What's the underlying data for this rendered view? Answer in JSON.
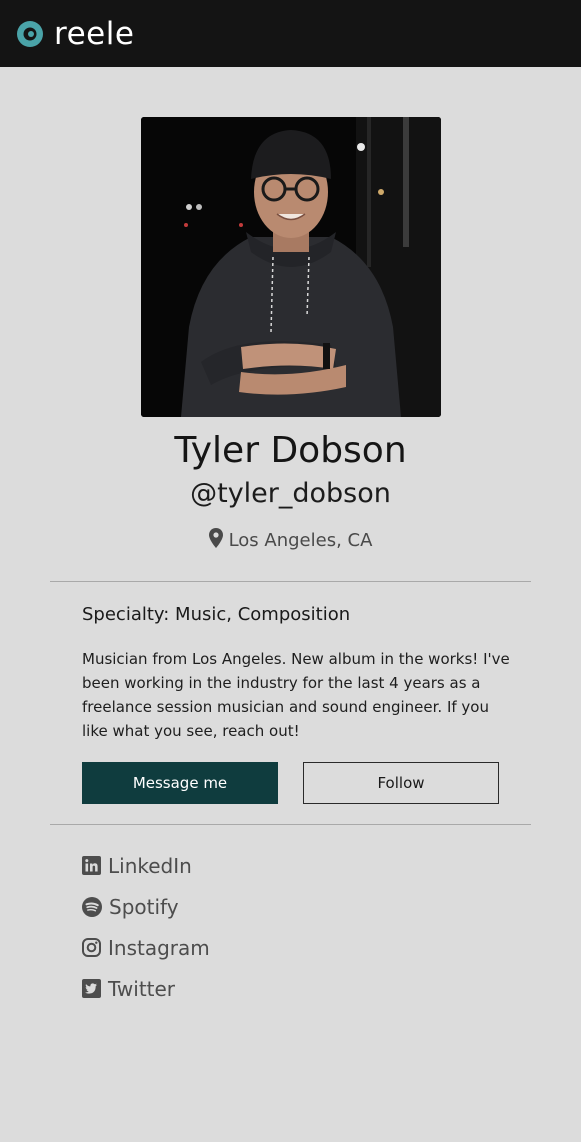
{
  "app": {
    "brand": "reele"
  },
  "profile": {
    "name": "Tyler Dobson",
    "handle": "@tyler_dobson",
    "location": "Los Angeles, CA",
    "specialty": "Specialty: Music, Composition",
    "bio": "Musician from Los Angeles. New album in the works! I've been working in the industry for the last 4 years as a freelance session musician and sound engineer. If you like what you see, reach out!"
  },
  "actions": {
    "message_label": "Message me",
    "follow_label": "Follow"
  },
  "social": [
    {
      "icon": "linkedin-icon",
      "label": "LinkedIn"
    },
    {
      "icon": "spotify-icon",
      "label": "Spotify"
    },
    {
      "icon": "instagram-icon",
      "label": "Instagram"
    },
    {
      "icon": "twitter-icon",
      "label": "Twitter"
    }
  ],
  "colors": {
    "topbar": "#141414",
    "accent": "#0f3c3e",
    "logo": "#4aa3a8",
    "background": "#dcdcdc"
  }
}
